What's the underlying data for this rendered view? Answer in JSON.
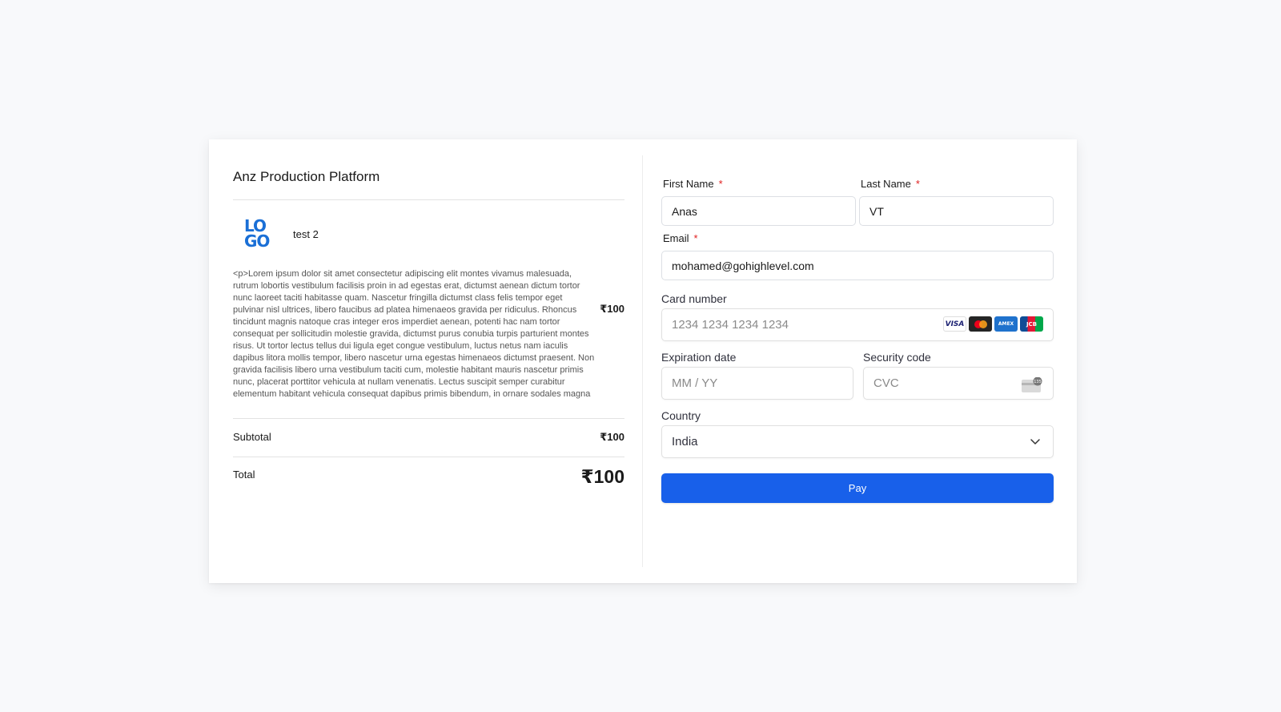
{
  "order": {
    "platform_title": "Anz Production Platform",
    "logo_line1": "LO",
    "logo_line2": "GO",
    "product_name": "test 2",
    "product_description": "<p>Lorem ipsum dolor sit amet consectetur adipiscing elit montes vivamus malesuada, rutrum lobortis vestibulum facilisis proin in ad egestas erat, dictumst aenean dictum tortor nunc laoreet taciti habitasse quam. Nascetur fringilla dictumst class felis tempor eget pulvinar nisl ultrices, libero faucibus ad platea himenaeos gravida per ridiculus. Rhoncus tincidunt magnis natoque cras integer eros imperdiet aenean, potenti hac nam tortor consequat per sollicitudin molestie gravida, dictumst purus conubia turpis parturient montes risus. Ut tortor lectus tellus dui ligula eget congue vestibulum, luctus netus nam iaculis dapibus litora mollis tempor, libero nascetur urna egestas himenaeos dictumst praesent. Non gravida facilisis libero urna vestibulum taciti cum, molestie habitant mauris nascetur primis nunc, placerat porttitor vehicula at nullam venenatis. Lectus suscipit semper curabitur elementum habitant vehicula consequat dapibus primis bibendum, in ornare sodales magna",
    "product_price": "₹100",
    "subtotal_label": "Subtotal",
    "subtotal_value": "₹100",
    "total_label": "Total",
    "total_value": "₹100"
  },
  "form": {
    "first_name_label": "First Name",
    "first_name_value": "Anas",
    "last_name_label": "Last Name",
    "last_name_value": "VT",
    "email_label": "Email",
    "email_value": "mohamed@gohighlevel.com",
    "required_mark": "*",
    "card_number_label": "Card number",
    "card_number_placeholder": "1234 1234 1234 1234",
    "card_brands": [
      "VISA",
      "MC",
      "AMEX",
      "JCB"
    ],
    "expiration_label": "Expiration date",
    "expiration_placeholder": "MM / YY",
    "security_label": "Security code",
    "security_placeholder": "CVC",
    "cvc_badge": "135",
    "country_label": "Country",
    "country_value": "India",
    "pay_label": "Pay"
  },
  "colors": {
    "accent": "#1860ea",
    "logo": "#1a6fd6",
    "required": "#e02020"
  }
}
